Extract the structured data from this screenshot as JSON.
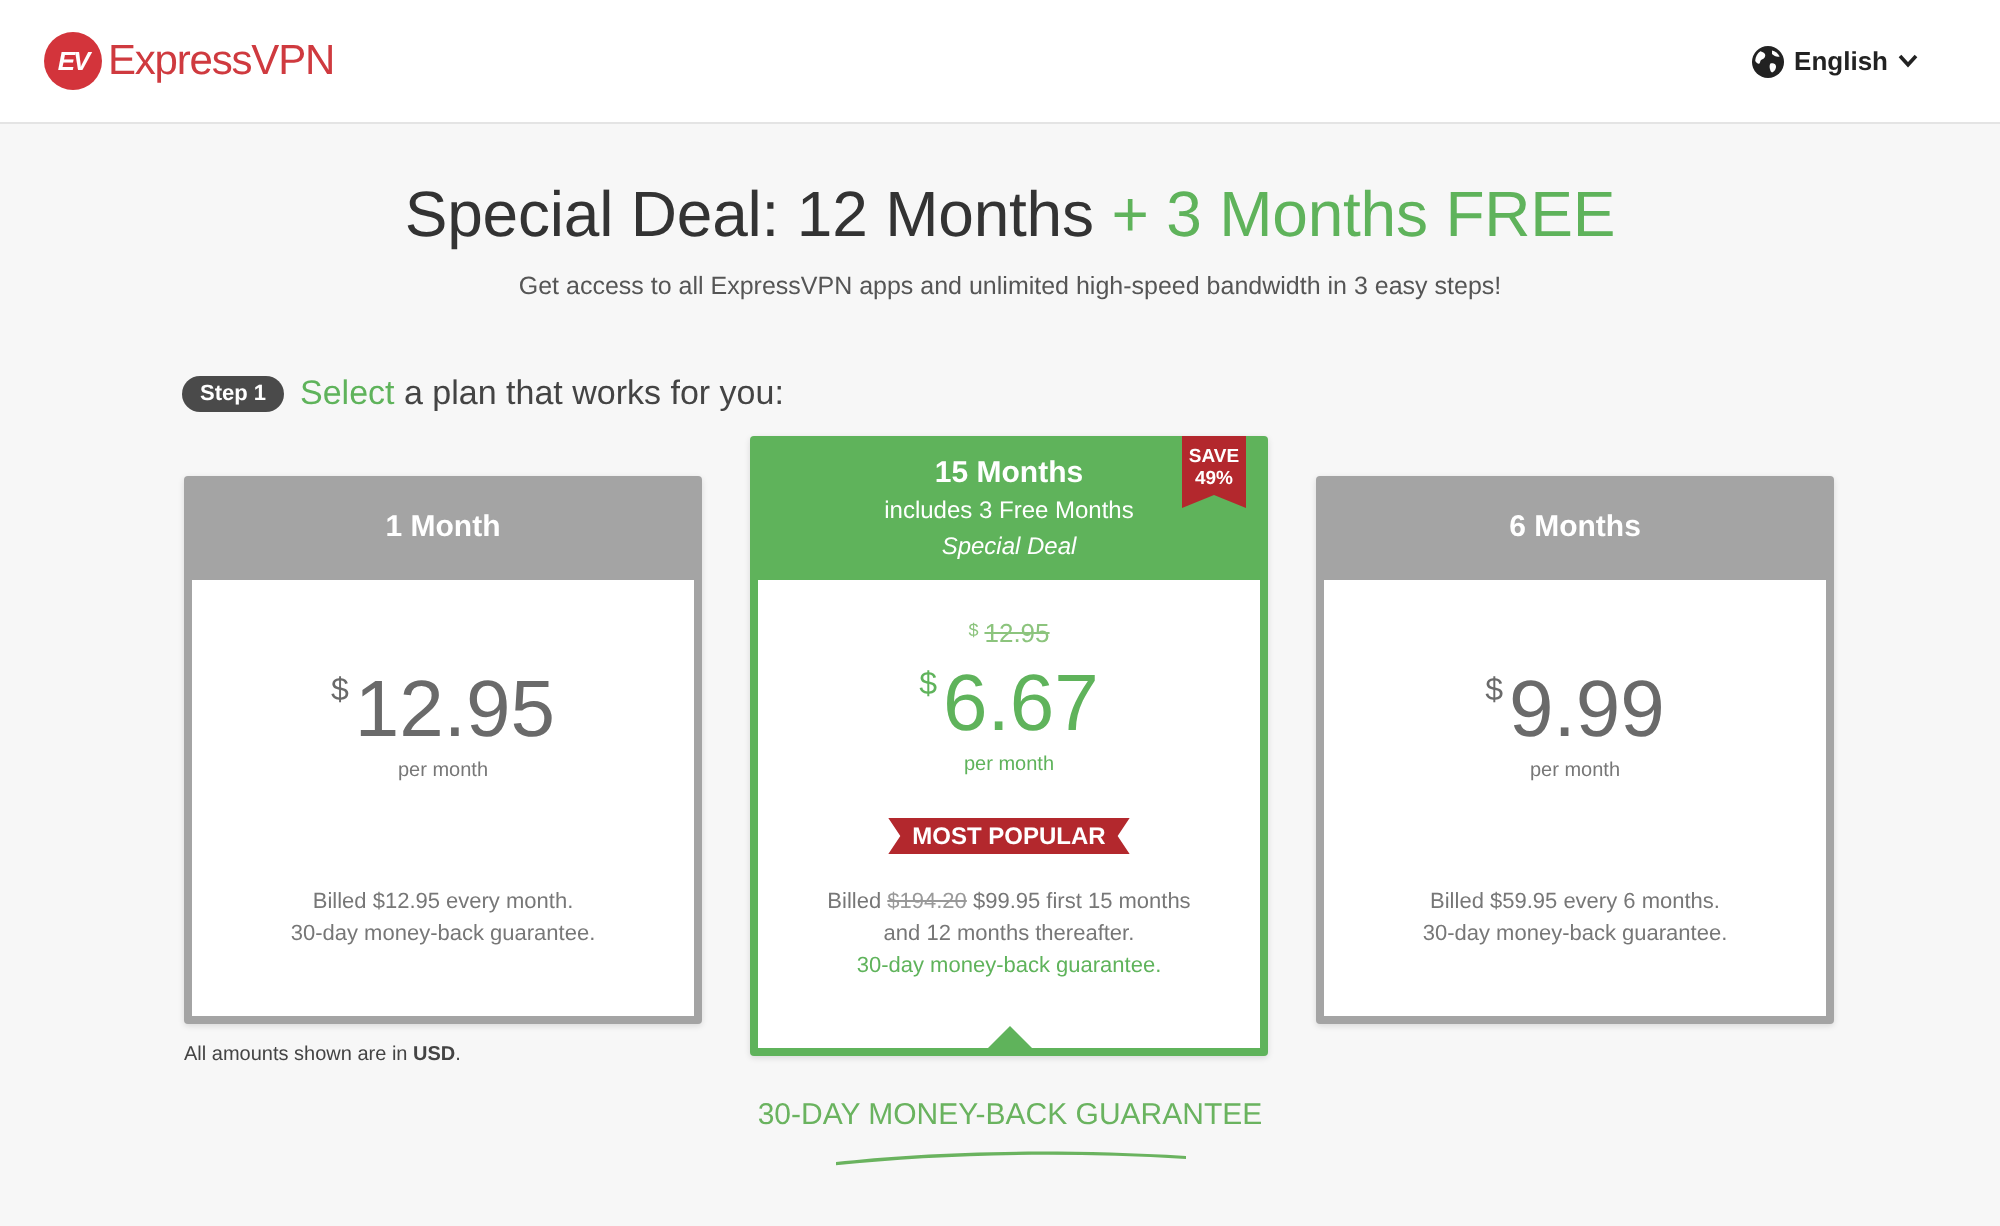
{
  "header": {
    "logo": {
      "mark": "EV",
      "name": "ExpressVPN"
    },
    "language": {
      "label": "English"
    }
  },
  "hero": {
    "title": "Special Deal: 12 Months",
    "title_highlight": "+ 3 Months FREE",
    "subtitle": "Get access to all ExpressVPN apps and unlimited high-speed bandwidth in 3 easy steps!"
  },
  "step": {
    "badge": "Step 1",
    "highlight": "Select",
    "text": "a plan that works for you:"
  },
  "plans": [
    {
      "name": "1 Month",
      "selected": false,
      "price": {
        "currency": "$",
        "amount": "12.95"
      },
      "period": "per month",
      "billing": [
        [
          {
            "text": "Billed $12.95 every month.",
            "struck": false
          }
        ]
      ],
      "guarantee": "30-day money-back guarantee."
    },
    {
      "name": "15 Months",
      "subtitle": "includes 3 Free Months",
      "tagline": "Special Deal",
      "selected": true,
      "save_ribbon": [
        "SAVE",
        "49%"
      ],
      "old_price": {
        "currency": "$",
        "amount": "12.95"
      },
      "price": {
        "currency": "$",
        "amount": "6.67"
      },
      "period": "per month",
      "badge": "MOST POPULAR",
      "billing": [
        [
          {
            "text": "Billed",
            "struck": false
          },
          {
            "text": "$194.20",
            "struck": true
          },
          {
            "text": "$99.95 first 15 months",
            "struck": false
          }
        ],
        [
          {
            "text": "and 12 months thereafter.",
            "struck": false
          }
        ]
      ],
      "guarantee": "30-day money-back guarantee."
    },
    {
      "name": "6 Months",
      "selected": false,
      "price": {
        "currency": "$",
        "amount": "9.99"
      },
      "period": "per month",
      "billing": [
        [
          {
            "text": "Billed $59.95 every 6 months.",
            "struck": false
          }
        ]
      ],
      "guarantee": "30-day money-back guarantee."
    }
  ],
  "currency_note": "All amounts shown are in **USD**.",
  "guarantee_banner": {
    "text": "30-DAY MONEY-BACK GUARANTEE"
  }
}
